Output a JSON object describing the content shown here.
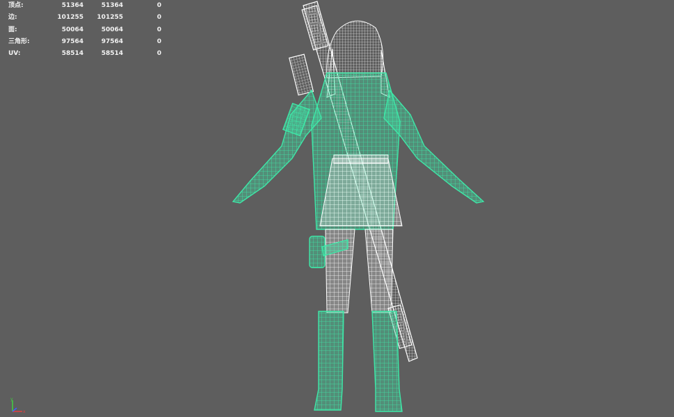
{
  "hud": {
    "rows": [
      {
        "label": "顶点:",
        "v1": "51364",
        "v2": "51364",
        "v3": "0"
      },
      {
        "label": "边:",
        "v1": "101255",
        "v2": "101255",
        "v3": "0"
      },
      {
        "label": "面:",
        "v1": "50064",
        "v2": "50064",
        "v3": "0"
      },
      {
        "label": "三角形:",
        "v1": "97564",
        "v2": "97564",
        "v3": "0"
      },
      {
        "label": "UV:",
        "v1": "58514",
        "v2": "58514",
        "v3": "0"
      }
    ]
  },
  "axis": {
    "y_label": "y",
    "x_label": "x"
  },
  "colors": {
    "viewport_bg": "#5e5e5e",
    "wire_selected": "#3ee8a8",
    "wire_unselected": "#ffffff",
    "axis_x": "#e04040",
    "axis_y": "#40d040",
    "axis_z": "#4060ff"
  }
}
